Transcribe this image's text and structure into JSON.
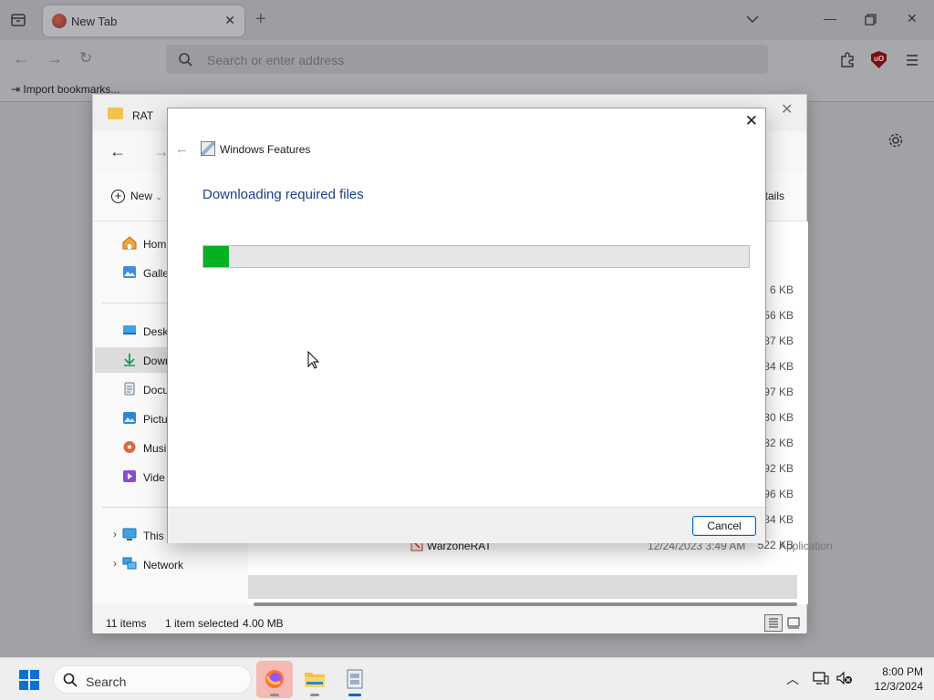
{
  "browser": {
    "tab_title": "New Tab",
    "address_placeholder": "Search or enter address",
    "bookmark_import": "Import bookmarks..."
  },
  "explorer": {
    "title": "RAT",
    "new_label": "New",
    "details_label": "tails",
    "sidebar": {
      "home": "Hom",
      "gallery": "Galler",
      "desktop": "Deskt",
      "downloads": "Down",
      "documents": "Docu",
      "pictures": "Pictu",
      "music": "Musi",
      "videos": "Vide",
      "this_pc": "This I",
      "network": "Network"
    },
    "sizes": [
      "6 KB",
      "56 KB",
      "87 KB",
      "84 KB",
      "97 KB",
      "30 KB",
      "32 KB",
      "92 KB",
      "96 KB",
      "84 KB",
      "522 KB"
    ],
    "last_row": {
      "name": "WarzoneRAT",
      "date": "12/24/2023 3:49 AM",
      "type": "Application"
    },
    "status": {
      "items": "11 items",
      "selected": "1 item selected",
      "size": "4.00 MB"
    }
  },
  "dialog": {
    "title": "Windows Features",
    "heading": "Downloading required files",
    "progress_fraction": 0.047,
    "cancel_label": "Cancel"
  },
  "taskbar": {
    "search_label": "Search",
    "time": "8:00 PM",
    "date": "12/3/2024"
  },
  "colors": {
    "progress_fill": "#06b025",
    "heading_blue": "#1e3f8c",
    "accent": "#0067c0"
  }
}
